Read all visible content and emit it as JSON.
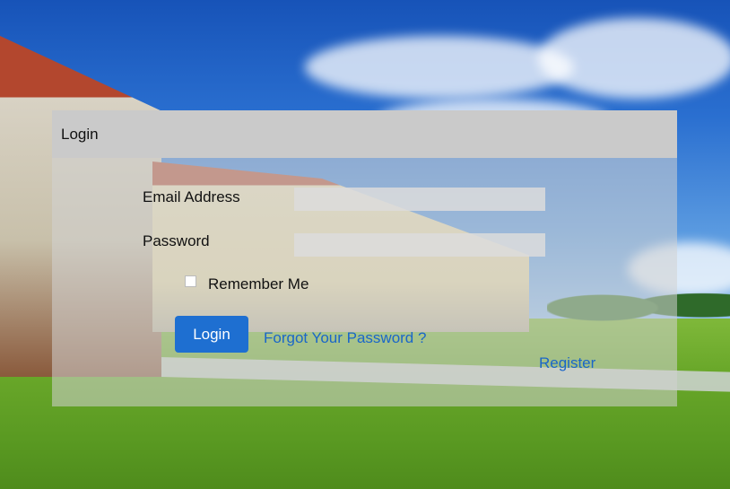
{
  "panel": {
    "title": "Login"
  },
  "form": {
    "email_label": "Email Address",
    "email_value": "",
    "password_label": "Password",
    "password_value": "",
    "remember_label": "Remember Me",
    "remember_checked": false,
    "login_button": "Login",
    "forgot_link": "Forgot Your Password ?",
    "register_link": "Register"
  },
  "colors": {
    "accent": "#1e6fd1",
    "link": "#1a66c9",
    "header_bg": "#cacaca"
  }
}
